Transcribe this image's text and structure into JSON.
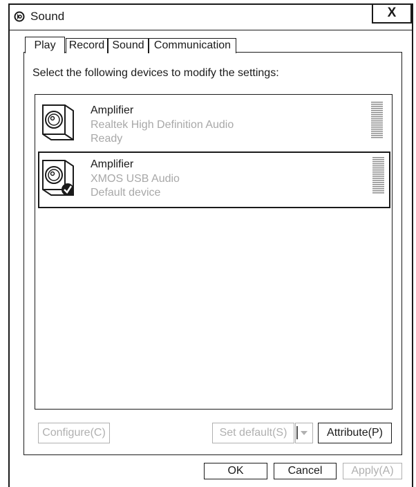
{
  "window": {
    "title": "Sound",
    "close_label": "X"
  },
  "tabs": [
    {
      "label": "Play",
      "selected": true
    },
    {
      "label": "Record",
      "selected": false
    },
    {
      "label": "Sound",
      "selected": false
    },
    {
      "label": "Communication",
      "selected": false
    }
  ],
  "instruction": "Select the following devices to modify the settings:",
  "devices": [
    {
      "name": "Amplifier",
      "driver": "Realtek High Definition Audio",
      "status": "Ready",
      "icon": "speaker-icon",
      "selected": false,
      "is_default": false
    },
    {
      "name": "Amplifier",
      "driver": "XMOS USB Audio",
      "status": "Default device",
      "icon": "speaker-icon",
      "selected": true,
      "is_default": true
    }
  ],
  "buttons": {
    "configure": "Configure(C)",
    "set_default": "Set default(S)",
    "attribute": "Attribute(P)",
    "ok": "OK",
    "cancel": "Cancel",
    "apply": "Apply(A)"
  },
  "colors": {
    "disabled_text": "#b0b0b0",
    "secondary_text": "#a8a8a8",
    "ink": "#1a1a1a"
  }
}
